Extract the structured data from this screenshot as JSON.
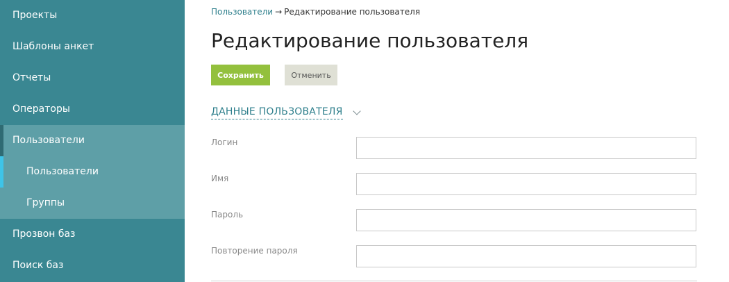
{
  "sidebar": {
    "items": [
      {
        "label": "Проекты"
      },
      {
        "label": "Шаблоны анкет"
      },
      {
        "label": "Отчеты"
      },
      {
        "label": "Операторы"
      },
      {
        "label": "Пользователи"
      },
      {
        "label": "Пользователи"
      },
      {
        "label": "Группы"
      },
      {
        "label": "Прозвон баз"
      },
      {
        "label": "Поиск баз"
      }
    ]
  },
  "breadcrumb": {
    "parent": "Пользователи",
    "separator": "→",
    "current": "Редактирование пользователя"
  },
  "page": {
    "title": "Редактирование пользователя"
  },
  "toolbar": {
    "save_label": "Сохранить",
    "cancel_label": "Отменить"
  },
  "section": {
    "title": "ДАННЫЕ ПОЛЬЗОВАТЕЛЯ"
  },
  "form": {
    "login": {
      "label": "Логин",
      "value": ""
    },
    "name": {
      "label": "Имя",
      "value": ""
    },
    "password": {
      "label": "Пароль",
      "value": ""
    },
    "password_repeat": {
      "label": "Повторение пароля",
      "value": ""
    }
  },
  "colors": {
    "sidebar_bg": "#3a8792",
    "sidebar_active_bg": "#5e9fa7",
    "current_indicator": "#3ec4e8",
    "save_button": "#93c03d",
    "cancel_button": "#dfe0d5",
    "link": "#2e7f8c"
  }
}
